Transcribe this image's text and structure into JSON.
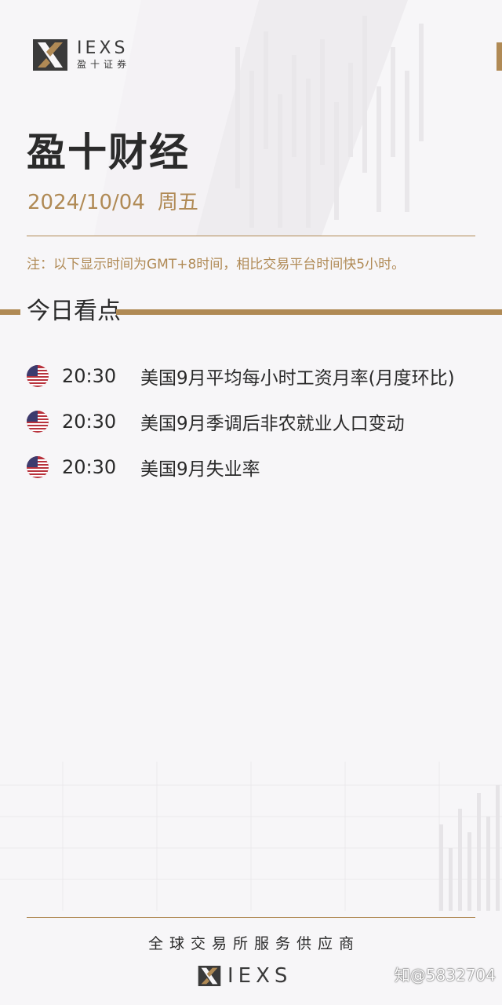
{
  "brand": {
    "logo_en": "IEXS",
    "logo_cn": "盈十证券",
    "accent_color": "#b08a55"
  },
  "header": {
    "title": "盈十财经",
    "date": "2024/10/04",
    "weekday": "周五"
  },
  "note": "注：以下显示时间为GMT+8时间，相比交易平台时间快5小时。",
  "section": {
    "title": "今日看点"
  },
  "events": [
    {
      "flag_icon": "us-flag-icon",
      "time": "20:30",
      "text": "美国9月平均每小时工资月率(月度环比)"
    },
    {
      "flag_icon": "us-flag-icon",
      "time": "20:30",
      "text": "美国9月季调后非农就业人口变动"
    },
    {
      "flag_icon": "us-flag-icon",
      "time": "20:30",
      "text": "美国9月失业率"
    }
  ],
  "footer": {
    "slogan": "全球交易所服务供应商",
    "logo_en": "IEXS"
  },
  "watermark": "知@5832704"
}
